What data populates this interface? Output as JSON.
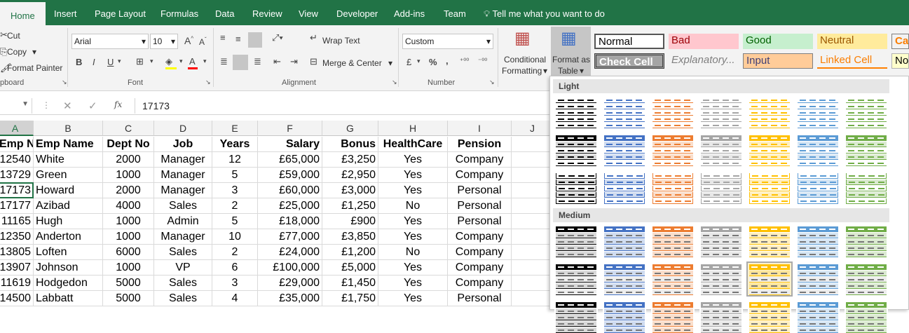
{
  "tabs": [
    "Home",
    "Insert",
    "Page Layout",
    "Formulas",
    "Data",
    "Review",
    "View",
    "Developer",
    "Add-ins",
    "Team"
  ],
  "tell_me": "Tell me what you want to do",
  "clipboard": {
    "cut": "Cut",
    "copy": "Copy",
    "format_painter": "Format Painter",
    "group": "pboard"
  },
  "font": {
    "name": "Arial",
    "size": "10",
    "group": "Font",
    "bold": "B",
    "italic": "I",
    "underline": "U"
  },
  "alignment": {
    "wrap": "Wrap Text",
    "merge": "Merge & Center",
    "group": "Alignment"
  },
  "number": {
    "format": "Custom",
    "group": "Number",
    "currency": "£",
    "percent": "%",
    "comma": ","
  },
  "styles_ribbon": {
    "conditional": "Conditional",
    "formatting": "Formatting",
    "format_as": "Format as",
    "table": "Table"
  },
  "cell_styles": {
    "normal": "Normal",
    "bad": "Bad",
    "good": "Good",
    "neutral": "Neutral",
    "calc": "Cal",
    "check": "Check Cell",
    "explanatory": "Explanatory...",
    "input": "Input",
    "linked": "Linked Cell",
    "note": "Not"
  },
  "formula_bar": {
    "value": "17173",
    "fx": "fx"
  },
  "columns": [
    "A",
    "B",
    "C",
    "D",
    "E",
    "F",
    "G",
    "H",
    "I",
    "J"
  ],
  "headers": [
    "Emp No",
    "Emp Name",
    "Dept No",
    "Job",
    "Years",
    "Salary",
    "Bonus",
    "HealthCare",
    "Pension"
  ],
  "rows": [
    [
      "12540",
      "White",
      "2000",
      "Manager",
      "12",
      "£65,000",
      "£3,250",
      "Yes",
      "Company"
    ],
    [
      "13729",
      "Green",
      "1000",
      "Manager",
      "5",
      "£59,000",
      "£2,950",
      "Yes",
      "Company"
    ],
    [
      "17173",
      "Howard",
      "2000",
      "Manager",
      "3",
      "£60,000",
      "£3,000",
      "Yes",
      "Personal"
    ],
    [
      "17177",
      "Azibad",
      "4000",
      "Sales",
      "2",
      "£25,000",
      "£1,250",
      "No",
      "Personal"
    ],
    [
      "11165",
      "Hugh",
      "1000",
      "Admin",
      "5",
      "£18,000",
      "£900",
      "Yes",
      "Personal"
    ],
    [
      "12350",
      "Anderton",
      "1000",
      "Manager",
      "10",
      "£77,000",
      "£3,850",
      "Yes",
      "Company"
    ],
    [
      "13805",
      "Loften",
      "6000",
      "Sales",
      "2",
      "£24,000",
      "£1,200",
      "No",
      "Company"
    ],
    [
      "13907",
      "Johnson",
      "1000",
      "VP",
      "6",
      "£100,000",
      "£5,000",
      "Yes",
      "Company"
    ],
    [
      "11619",
      "Hodgedon",
      "5000",
      "Sales",
      "3",
      "£29,000",
      "£1,450",
      "Yes",
      "Company"
    ],
    [
      "14500",
      "Labbatt",
      "5000",
      "Sales",
      "4",
      "£35,000",
      "£1,750",
      "Yes",
      "Personal"
    ]
  ],
  "gallery": {
    "light": "Light",
    "medium": "Medium",
    "colors": [
      "#000000",
      "#4472c4",
      "#ed7d31",
      "#a5a5a5",
      "#ffc000",
      "#5b9bd5",
      "#70ad47"
    ]
  }
}
